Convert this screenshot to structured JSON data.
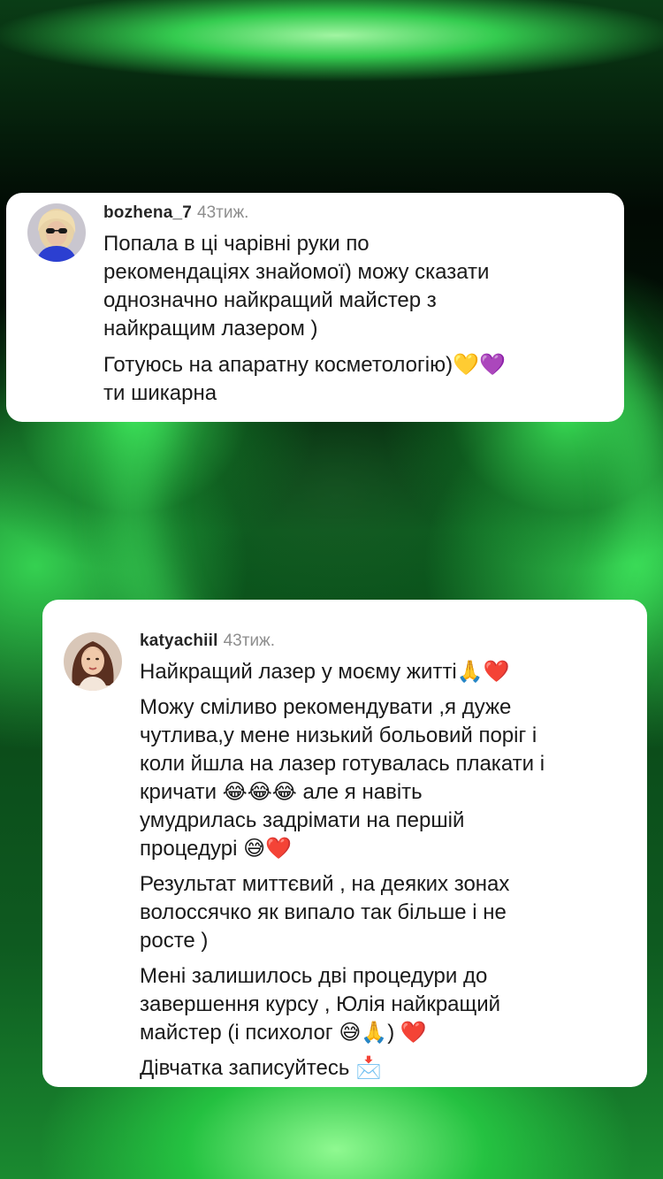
{
  "comments": [
    {
      "username": "bozhena_7",
      "time": "43тиж.",
      "paragraphs": [
        "Попала в ці чарівні руки по\nрекомендаціях знайомої) можу сказати\nоднозначно найкращий майстер з\nнайкращим лазером )",
        "Готуюсь на апаратну косметологію)💛💜\nти шикарна"
      ]
    },
    {
      "username": "katyachiil",
      "time": "43тиж.",
      "paragraphs": [
        "Найкращий лазер у моєму житті🙏❤️",
        "Можу сміливо рекомендувати ,я дуже\nчутлива,у мене низький больовий поріг і\nколи йшла на лазер готувалась плакати і\nкричати 😂😂😂 але я навіть\nумудрилась задрімати на першій\nпроцедурі 😅❤️",
        "Результат миттєвий , на деяких зонах\nволоссячко як випало так більше і не\nросте )",
        "Мені залишилось дві процедури до\nзавершення курсу , Юлія найкращий\nмайстер (і психолог 😅🙏) ❤️",
        "Дівчатка записуйтесь 📩"
      ]
    }
  ],
  "icons": {
    "avatar_1": "avatar-blonde-sunglasses",
    "avatar_2": "avatar-brunette"
  },
  "colors": {
    "card_background": "#ffffff",
    "username": "#262626",
    "timestamp": "#8e8e8e",
    "text": "#1a1a1a",
    "background_glow": "#3ce65a"
  }
}
